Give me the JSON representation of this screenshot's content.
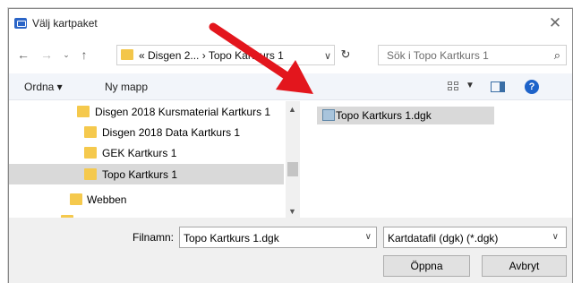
{
  "window": {
    "title": "Välj kartpaket"
  },
  "nav": {
    "address_text": "«  Disgen 2...  ›  Topo Kartkurs 1",
    "search_placeholder": "Sök i Topo Kartkurs 1"
  },
  "toolbar": {
    "organize_label": "Ordna ▾",
    "new_folder_label": "Ny mapp"
  },
  "tree": {
    "items": [
      {
        "label": "Disgen 2018 Kursmaterial Kartkurs 1"
      },
      {
        "label": "Disgen 2018 Data Kartkurs 1"
      },
      {
        "label": "GEK Kartkurs 1"
      },
      {
        "label": "Topo Kartkurs 1",
        "selected": true
      },
      {
        "label": "Webben"
      }
    ]
  },
  "files": [
    {
      "label": "Topo Kartkurs 1.dgk"
    }
  ],
  "footer": {
    "filename_label": "Filnamn:",
    "filename_value": "Topo Kartkurs 1.dgk",
    "filetype_value": "Kartdatafil (dgk) (*.dgk)",
    "open_label": "Öppna",
    "cancel_label": "Avbryt"
  },
  "colors": {
    "selection": "#d9d9d9",
    "folder": "#f5c94d",
    "arrow": "#e3161d",
    "toolbar_bg": "#f2f5fa"
  }
}
